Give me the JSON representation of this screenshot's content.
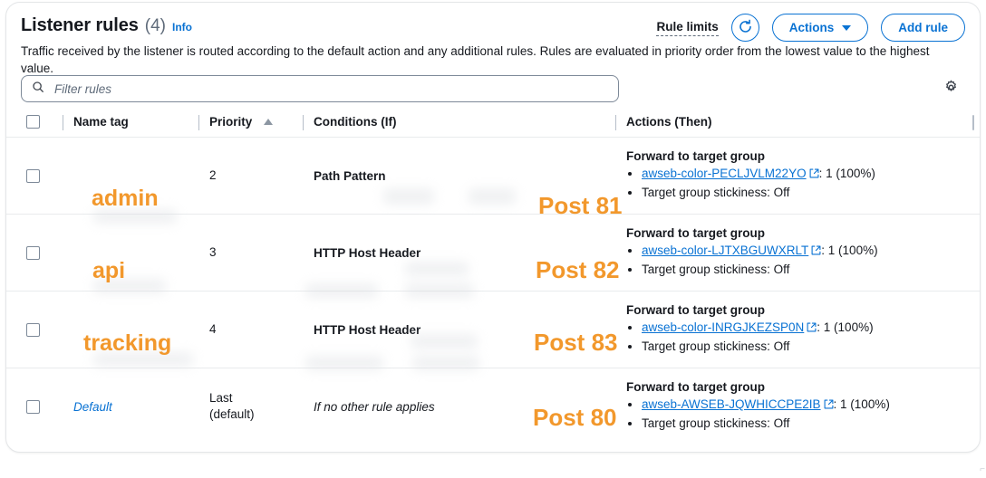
{
  "header": {
    "title": "Listener rules",
    "count": "(4)",
    "info_label": "Info",
    "description": "Traffic received by the listener is routed according to the default action and any additional rules. Rules are evaluated in priority order from the lowest value to the highest value.",
    "rule_limits_label": "Rule limits",
    "refresh_icon": "refresh-icon",
    "actions_label": "Actions",
    "add_rule_label": "Add rule"
  },
  "filter": {
    "placeholder": "Filter rules",
    "search_icon": "search-icon",
    "preferences_icon": "gear-icon"
  },
  "table": {
    "columns": [
      {
        "key": "select",
        "label": ""
      },
      {
        "key": "name_tag",
        "label": "Name tag"
      },
      {
        "key": "priority",
        "label": "Priority",
        "sort": "asc"
      },
      {
        "key": "conditions",
        "label": "Conditions (If)"
      },
      {
        "key": "actions",
        "label": "Actions (Then)"
      }
    ],
    "rows": [
      {
        "name_tag": "admin",
        "name_overlay": "admin",
        "priority": "2",
        "conditions": "Path Pattern",
        "conditions_italic": false,
        "action_title": "Forward to target group",
        "target_group": "awseb-color-PECLJVLM22YO",
        "target_weight": ": 1 (100%)",
        "stickiness": "Target group stickiness: Off",
        "post_overlay": "Post 81",
        "external_link_icon": "external-link-icon"
      },
      {
        "name_tag": "api",
        "name_overlay": "api",
        "priority": "3",
        "conditions": "HTTP Host Header",
        "conditions_italic": false,
        "action_title": "Forward to target group",
        "target_group": "awseb-color-LJTXBGUWXRLT",
        "target_weight": ": 1 (100%)",
        "stickiness": "Target group stickiness: Off",
        "post_overlay": "Post 82",
        "external_link_icon": "external-link-icon"
      },
      {
        "name_tag": "tracking",
        "name_overlay": "tracking",
        "priority": "4",
        "conditions": "HTTP Host Header",
        "conditions_italic": false,
        "action_title": "Forward to target group",
        "target_group": "awseb-color-INRGJKEZSP0N",
        "target_weight": ": 1 (100%)",
        "stickiness": "Target group stickiness: Off",
        "post_overlay": "Post 83",
        "external_link_icon": "external-link-icon"
      },
      {
        "name_tag": "Default",
        "name_overlay": "",
        "priority": "Last\n(default)",
        "priority_line1": "Last",
        "priority_line2": "(default)",
        "conditions": "If no other rule applies",
        "conditions_italic": true,
        "action_title": "Forward to target group",
        "target_group": "awseb-AWSEB-JQWHICCPE2IB",
        "target_weight": ": 1 (100%)",
        "stickiness": "Target group stickiness: Off",
        "post_overlay": "Post 80",
        "external_link_icon": "external-link-icon"
      }
    ]
  },
  "colors": {
    "annotation_orange": "#f2982c",
    "link_blue": "#0972d3",
    "text_dark": "#16191f",
    "muted": "#5f6b7a"
  }
}
